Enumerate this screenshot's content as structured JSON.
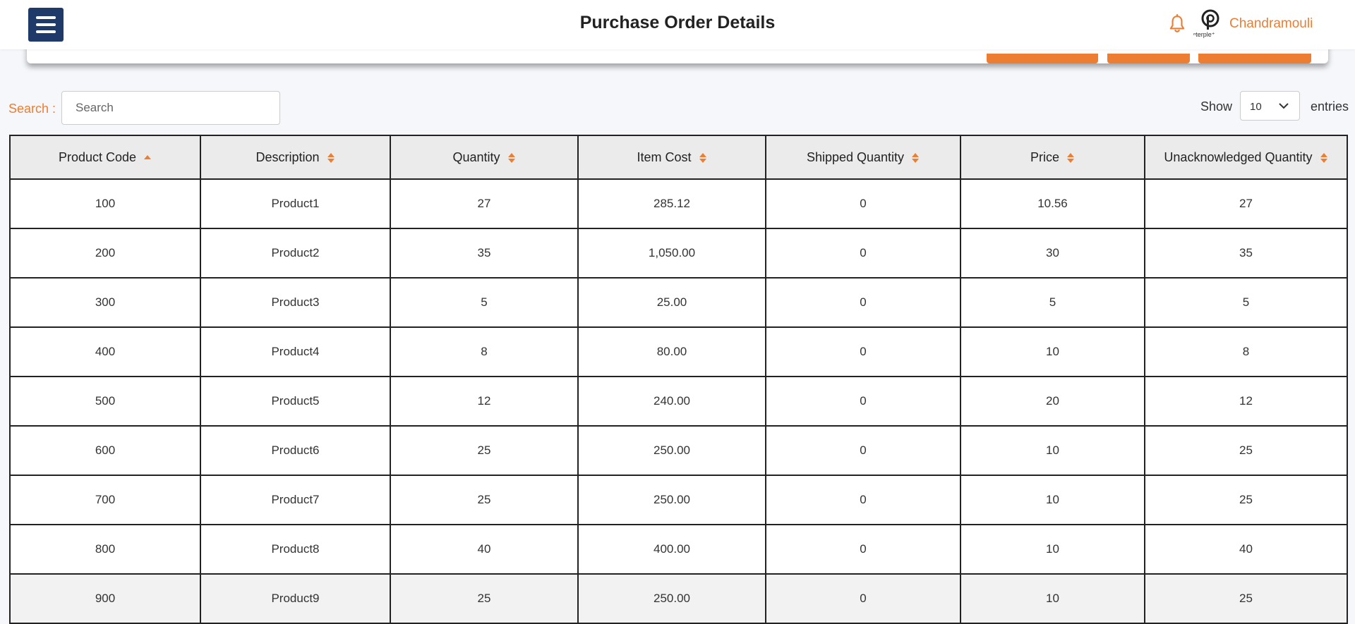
{
  "header": {
    "title": "Purchase Order Details",
    "logo_text": "ⁿterple⁺",
    "username": "Chandramouli"
  },
  "controls": {
    "search_label": "Search :",
    "search_placeholder": "Search",
    "search_value": "",
    "show_label": "Show",
    "entries_value": "10",
    "entries_label": "entries"
  },
  "table": {
    "columns": [
      {
        "label": "Product Code",
        "sort": "asc"
      },
      {
        "label": "Description",
        "sort": "none"
      },
      {
        "label": "Quantity",
        "sort": "none"
      },
      {
        "label": "Item Cost",
        "sort": "none"
      },
      {
        "label": "Shipped Quantity",
        "sort": "none"
      },
      {
        "label": "Price",
        "sort": "none"
      },
      {
        "label": "Unacknowledged Quantity",
        "sort": "none"
      }
    ],
    "rows": [
      {
        "cells": [
          "100",
          "Product1",
          "27",
          "285.12",
          "0",
          "10.56",
          "27"
        ]
      },
      {
        "cells": [
          "200",
          "Product2",
          "35",
          "1,050.00",
          "0",
          "30",
          "35"
        ]
      },
      {
        "cells": [
          "300",
          "Product3",
          "5",
          "25.00",
          "0",
          "5",
          "5"
        ]
      },
      {
        "cells": [
          "400",
          "Product4",
          "8",
          "80.00",
          "0",
          "10",
          "8"
        ]
      },
      {
        "cells": [
          "500",
          "Product5",
          "12",
          "240.00",
          "0",
          "20",
          "12"
        ]
      },
      {
        "cells": [
          "600",
          "Product6",
          "25",
          "250.00",
          "0",
          "10",
          "25"
        ]
      },
      {
        "cells": [
          "700",
          "Product7",
          "25",
          "250.00",
          "0",
          "10",
          "25"
        ]
      },
      {
        "cells": [
          "800",
          "Product8",
          "40",
          "400.00",
          "0",
          "10",
          "40"
        ]
      },
      {
        "cells": [
          "900",
          "Product9",
          "25",
          "250.00",
          "0",
          "10",
          "25"
        ]
      }
    ]
  },
  "colors": {
    "accent": "#ed7d31",
    "menu_bg": "#1f3a68",
    "header_bg": "#ebebeb"
  },
  "icons": {
    "menu": "hamburger-icon",
    "notifications": "bell-icon",
    "sort_asc": "sort-asc-icon",
    "sort_both": "sort-both-icon",
    "dropdown": "chevron-down-icon"
  }
}
